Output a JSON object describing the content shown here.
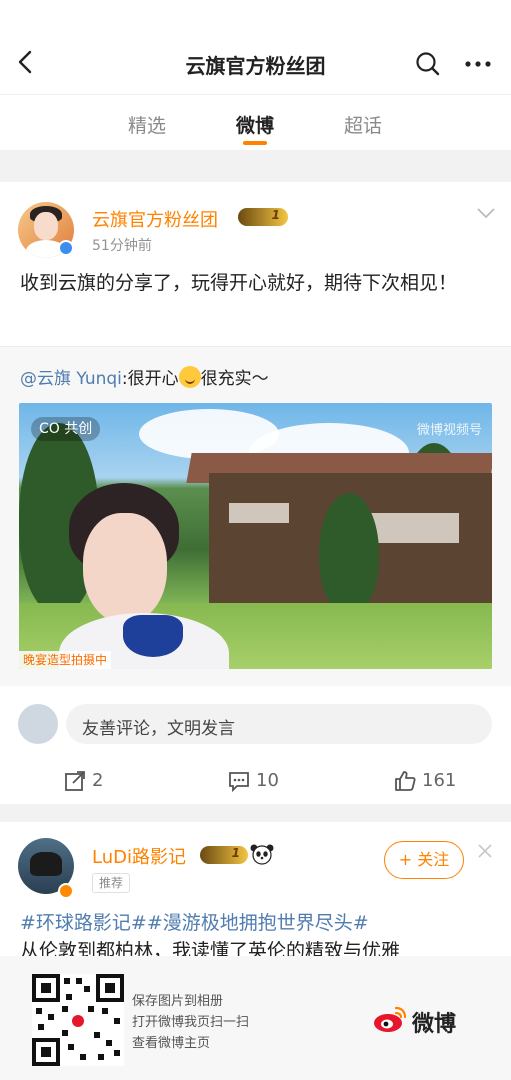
{
  "header": {
    "title": "云旗官方粉丝团",
    "back_icon": "chevron-left-icon",
    "search_icon": "search-icon",
    "more_icon": "ellipsis-icon"
  },
  "tabs": [
    {
      "label": "精选",
      "active": false
    },
    {
      "label": "微博",
      "active": true
    },
    {
      "label": "超话",
      "active": false
    }
  ],
  "accent_color": "#ff8200",
  "link_color": "#507daf",
  "post": {
    "author": "云旗官方粉丝团",
    "vip_level": "1",
    "time": "51分钟前",
    "text": "收到云旗的分享了，玩得开心就好，期待下次相见！",
    "repost": {
      "mention": "@云旗 Yunqi",
      "text_before_emoji": ":很开心",
      "text_after_emoji": "很充实～",
      "video": {
        "badge": "共创",
        "badge_prefix": "CO",
        "watermark": "微博视频号",
        "caption_tag": "晚宴造型拍摄中"
      }
    },
    "comment_placeholder": "友善评论，文明发言",
    "actions": {
      "reposts": "2",
      "comments": "10",
      "likes": "161"
    }
  },
  "second_post": {
    "author": "LuDi路影记",
    "vip_level": "1",
    "tag": "推荐",
    "follow_label": "+ 关注",
    "hashtags": "#环球路影记##漫游极地拥抱世界尽头#",
    "text": "从伦敦到都柏林，我读懂了英伦的精致与优雅"
  },
  "footer": {
    "line1": "保存图片到相册",
    "line2": "打开微博我页扫一扫",
    "line3": "查看微博主页",
    "brand": "微博"
  }
}
